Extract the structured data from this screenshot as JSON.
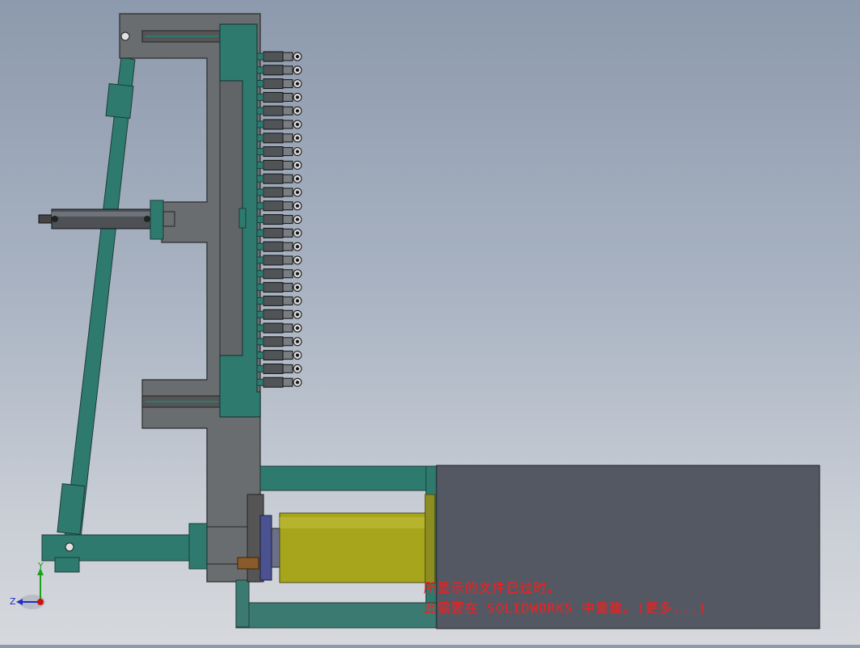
{
  "viewport": {
    "background_top": "#8d9aad",
    "background_bottom": "#d6d8dc"
  },
  "colors": {
    "plate_gray": "#6a6d70",
    "teal": "#2e7a6e",
    "cylinder_yellow": "#a7a51c",
    "motor_box": "#545862",
    "warning_red": "#ff1a1a"
  },
  "triad": {
    "x_label": "Z",
    "y_label": "Y"
  },
  "rebuild_notice": {
    "line1": "所显示的文件已过时。",
    "line2": "此需要在 SOLIDWORKS 中重建。(更多...)"
  },
  "gripper_count": 25
}
